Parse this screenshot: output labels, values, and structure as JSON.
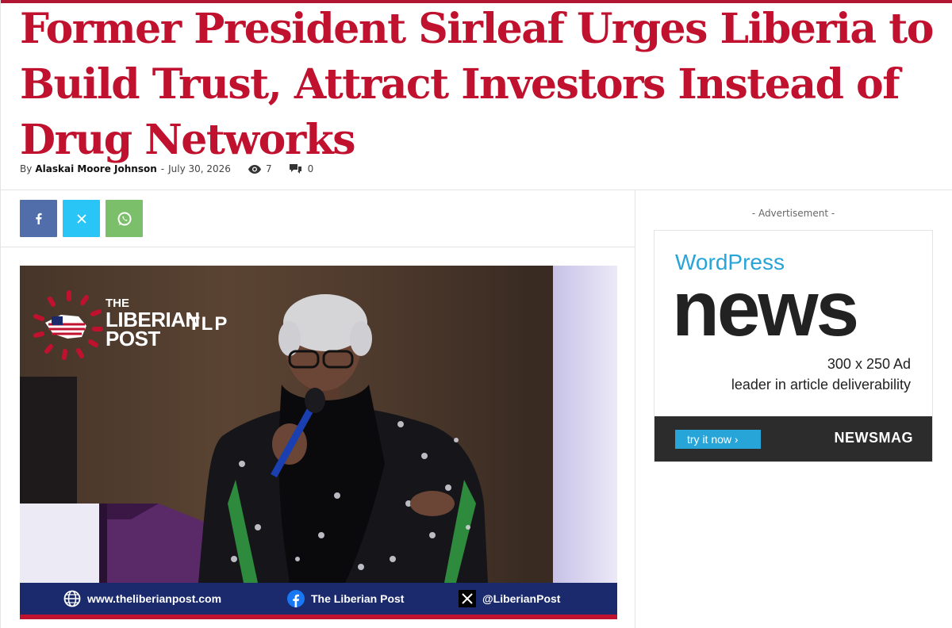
{
  "article": {
    "title": "Former President Sirleaf Urges Liberia to Build Trust, Attract Investors Instead of Drug Networks",
    "by_label": "By",
    "author": "Alaskai Moore Johnson",
    "separator": "-",
    "date": "July 30, 2026",
    "views": "7",
    "comments": "0"
  },
  "share": {
    "facebook_icon": "facebook-icon",
    "x_icon": "x-icon",
    "whatsapp_icon": "whatsapp-icon",
    "facebook_color": "#516eab",
    "x_color": "#29c5f6",
    "whatsapp_color": "#7bbf6a"
  },
  "photo": {
    "logo_line1": "THE",
    "logo_line2": "LIBERIAN",
    "logo_line3": "POST",
    "logo_mark": "TLP",
    "footer_website": "www.theliberianpost.com",
    "footer_facebook": "The Liberian Post",
    "footer_x": "@LiberianPost"
  },
  "sidebar": {
    "ad_label": "- Advertisement -",
    "ad": {
      "brand_top": "WordPress",
      "headline": "news",
      "size_text": "300 x 250 Ad",
      "tagline": "leader in article deliverability",
      "cta": "try it now ›",
      "brand": "NEWSMAG"
    }
  },
  "colors": {
    "title": "#c0112e",
    "accent_blue": "#27a4d8",
    "footer_navy": "#1a2a6c"
  }
}
